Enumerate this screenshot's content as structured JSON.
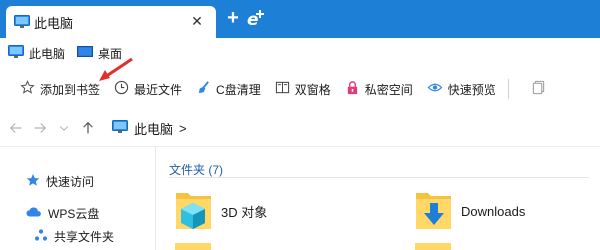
{
  "tab": {
    "title": "此电脑",
    "close": "✕",
    "new_tab": "+"
  },
  "bookmarks": [
    {
      "label": "此电脑",
      "icon": "monitor-icon"
    },
    {
      "label": "桌面",
      "icon": "desktop-icon"
    }
  ],
  "toolbar": {
    "add_bookmark": "添加到书签",
    "recent": "最近文件",
    "c_clean": "C盘清理",
    "dual_pane": "双窗格",
    "private_space": "私密空间",
    "quick_preview": "快速预览"
  },
  "address": {
    "path": "此电脑",
    "chevron": ">"
  },
  "sidebar": {
    "quick_access": "快速访问",
    "wps_cloud": "WPS云盘",
    "shared_folder": "共享文件夹"
  },
  "content": {
    "section_title": "文件夹 (7)",
    "files": [
      {
        "name": "3D 对象",
        "icon": "3d-objects-folder-icon"
      },
      {
        "name": "Downloads",
        "icon": "downloads-folder-icon"
      }
    ]
  },
  "colors": {
    "accent": "#1e7fd6",
    "annotation": "#e0302b",
    "section": "#1f5fa6"
  }
}
